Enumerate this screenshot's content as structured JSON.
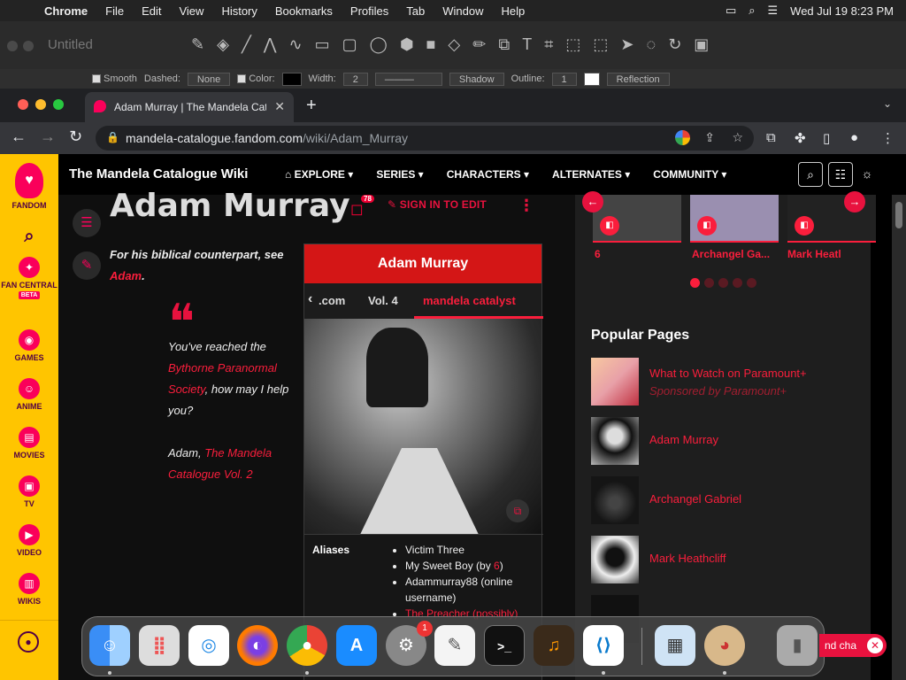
{
  "menubar": {
    "app": "Chrome",
    "items": [
      "File",
      "Edit",
      "View",
      "History",
      "Bookmarks",
      "Profiles",
      "Tab",
      "Window",
      "Help"
    ],
    "clock": "Wed Jul 19  8:23 PM"
  },
  "drawapp": {
    "title": "Untitled",
    "options": {
      "smooth": "Smooth",
      "dashed_label": "Dashed:",
      "dashed_value": "None",
      "color_label": "Color:",
      "width_label": "Width:",
      "width_value": "2",
      "shadow": "Shadow",
      "outline_label": "Outline:",
      "outline_value": "1",
      "reflection": "Reflection"
    }
  },
  "browser": {
    "tab_title": "Adam Murray | The Mandela Catalogue Wiki",
    "url_host": "mandela-catalogue.fandom.com",
    "url_path": "/wiki/Adam_Murray"
  },
  "rail": {
    "brand": "FANDOM",
    "items": [
      {
        "label": "FAN CENTRAL",
        "badge": "BETA"
      },
      {
        "label": "GAMES"
      },
      {
        "label": "ANIME"
      },
      {
        "label": "MOVIES"
      },
      {
        "label": "TV"
      },
      {
        "label": "VIDEO"
      },
      {
        "label": "WIKIS"
      }
    ]
  },
  "wiki": {
    "name": "The Mandela Catalogue Wiki",
    "nav": [
      "EXPLORE",
      "SERIES",
      "CHARACTERS",
      "ALTERNATES",
      "COMMUNITY"
    ]
  },
  "article": {
    "title": "Adam Murray",
    "talk_count": "78",
    "sign_in": "SIGN IN TO EDIT",
    "hatnote_prefix": "For his biblical counterpart, see ",
    "hatnote_link": "Adam",
    "hatnote_suffix": ".",
    "quote_1": "You've reached the ",
    "quote_link": "Bythorne Paranormal Society",
    "quote_2": ", how may I help you?",
    "quote_attrib": "Adam, ",
    "quote_attrib_link": "The Mandela Catalogue Vol. 2"
  },
  "infobox": {
    "title": "Adam Murray",
    "tabs": [
      ".com",
      "Vol. 4",
      "mandela catalyst"
    ],
    "row_key": "Aliases",
    "aliases": [
      "Victim Three",
      "My Sweet Boy (by ",
      "Adammurray88 (online username)",
      "The Preacher (possibly)"
    ],
    "alias_link": "6"
  },
  "sidebar": {
    "carousel": [
      "6",
      "Archangel Ga...",
      "Mark Heatl"
    ],
    "popular_title": "Popular Pages",
    "popular": [
      {
        "label": "What to Watch on Paramount+",
        "sub": "Sponsored by Paramount+"
      },
      {
        "label": "Adam Murray"
      },
      {
        "label": "Archangel Gabriel"
      },
      {
        "label": "Mark Heathcliff"
      }
    ]
  },
  "dock": {
    "update_badge": "1"
  },
  "chat": {
    "label": "nd cha"
  }
}
